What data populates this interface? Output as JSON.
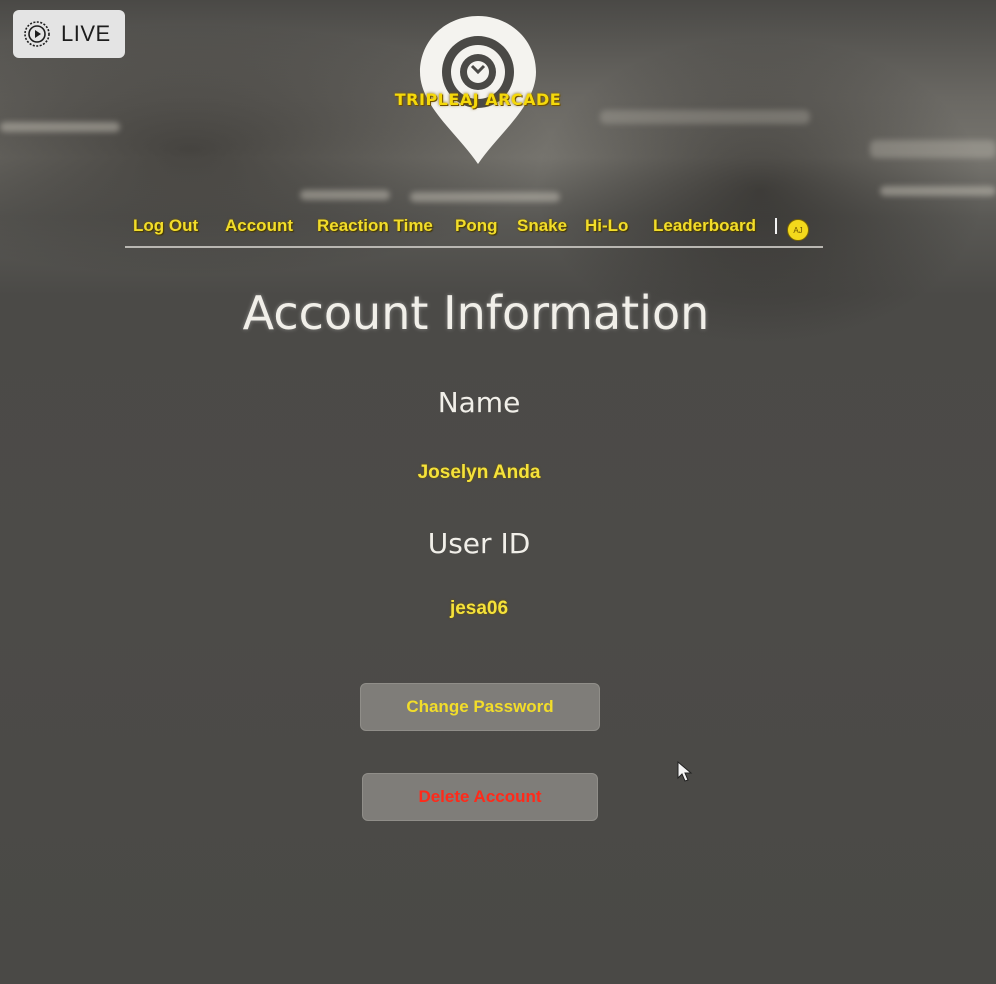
{
  "live_badge": {
    "label": "LIVE",
    "icon": "play-circle-icon"
  },
  "logo": {
    "text": "TRIPLEAJ ARCADE",
    "icon": "map-pin-icon"
  },
  "nav": {
    "items": [
      {
        "label": "Log Out"
      },
      {
        "label": "Account"
      },
      {
        "label": "Reaction Time"
      },
      {
        "label": "Pong"
      },
      {
        "label": "Snake"
      },
      {
        "label": "Hi-Lo"
      },
      {
        "label": "Leaderboard"
      }
    ],
    "avatar_initials": "AJ"
  },
  "page": {
    "title": "Account Information",
    "name_label": "Name",
    "name_value": "Joselyn Anda",
    "userid_label": "User ID",
    "userid_value": "jesa06"
  },
  "actions": {
    "change_password_label": "Change Password",
    "delete_account_label": "Delete Account"
  },
  "colors": {
    "accent_yellow": "#f2dd2a",
    "danger_red": "#ff2a1a",
    "background": "#4c4b48"
  }
}
